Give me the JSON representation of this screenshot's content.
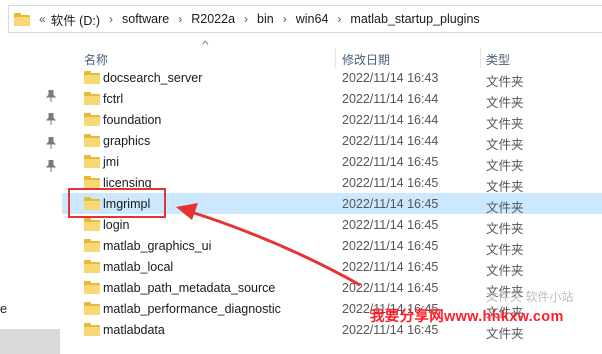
{
  "address_bar": {
    "chevron": "«",
    "separator": "›",
    "crumbs": [
      "软件 (D:)",
      "software",
      "R2022a",
      "bin",
      "win64",
      "matlab_startup_plugins"
    ]
  },
  "nav": {
    "partial_label": "e"
  },
  "columns": {
    "name": "名称",
    "date": "修改日期",
    "type": "类型"
  },
  "files": [
    {
      "name": "docsearch_server",
      "date": "2022/11/14 16:43",
      "type": "文件夹"
    },
    {
      "name": "fctrl",
      "date": "2022/11/14 16:44",
      "type": "文件夹"
    },
    {
      "name": "foundation",
      "date": "2022/11/14 16:44",
      "type": "文件夹"
    },
    {
      "name": "graphics",
      "date": "2022/11/14 16:44",
      "type": "文件夹"
    },
    {
      "name": "jmi",
      "date": "2022/11/14 16:45",
      "type": "文件夹"
    },
    {
      "name": "licensing",
      "date": "2022/11/14 16:45",
      "type": "文件夹"
    },
    {
      "name": "lmgrimpl",
      "date": "2022/11/14 16:45",
      "type": "文件夹",
      "selected": true
    },
    {
      "name": "login",
      "date": "2022/11/14 16:45",
      "type": "文件夹"
    },
    {
      "name": "matlab_graphics_ui",
      "date": "2022/11/14 16:45",
      "type": "文件夹"
    },
    {
      "name": "matlab_local",
      "date": "2022/11/14 16:45",
      "type": "文件夹"
    },
    {
      "name": "matlab_path_metadata_source",
      "date": "2022/11/14 16:45",
      "type": "文件夹"
    },
    {
      "name": "matlab_performance_diagnostic",
      "date": "2022/11/14 16:45",
      "type": "文件夹"
    },
    {
      "name": "matlabdata",
      "date": "2022/11/14 16:45",
      "type": "文件夹"
    }
  ],
  "annotation": {
    "color": "#e53333",
    "target": "lmgrimpl"
  },
  "watermark": {
    "text": "我要分享网www.hhkxw.com",
    "color": "#ff1f2a"
  },
  "faint_overlay_text": "文件夹 软件小站",
  "colors": {
    "selection": "#cce8ff",
    "folder": "#f8d775",
    "header_text": "#4c607a"
  }
}
